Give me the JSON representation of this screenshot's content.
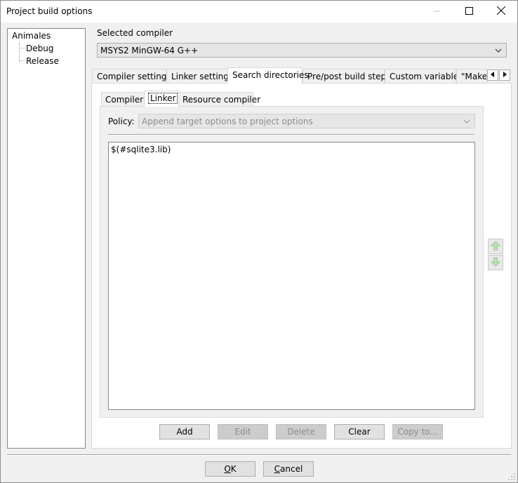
{
  "window": {
    "title": "Project build options"
  },
  "tree": {
    "root": "Animales",
    "children": [
      "Debug",
      "Release"
    ]
  },
  "compiler": {
    "label": "Selected compiler",
    "value": "MSYS2 MinGW-64 G++"
  },
  "tabs": [
    "Compiler settings",
    "Linker settings",
    "Search directories",
    "Pre/post build steps",
    "Custom variables",
    "\"Make\""
  ],
  "active_tab": "Search directories",
  "subtabs": [
    "Compiler",
    "Linker",
    "Resource compiler"
  ],
  "active_subtab": "Linker",
  "policy": {
    "label": "Policy:",
    "value": "Append target options to project options"
  },
  "directories": [
    "$(#sqlite3.lib)"
  ],
  "buttons": {
    "add": "Add",
    "edit": "Edit",
    "delete": "Delete",
    "clear": "Clear",
    "copy_to": "Copy to..."
  },
  "dialog_buttons": {
    "ok": "OK",
    "cancel": "Cancel"
  },
  "icons": {
    "minimize": "minimize-icon",
    "maximize": "maximize-icon",
    "close": "close-icon",
    "move_up": "arrow-up-icon",
    "move_down": "arrow-down-icon"
  },
  "colors": {
    "disabled_text": "#8c8c8c",
    "arrow_green": "#a8d8a0"
  }
}
